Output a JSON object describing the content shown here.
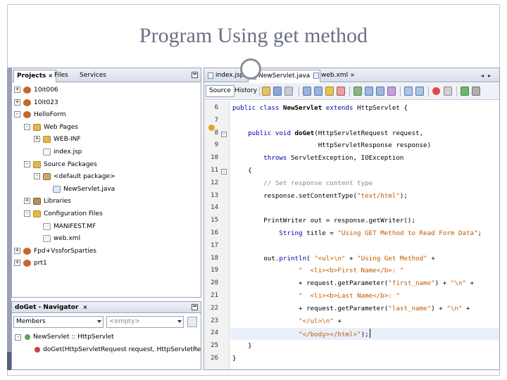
{
  "slide": {
    "title": "Program Using get method"
  },
  "projects_panel": {
    "tabs": [
      {
        "label": "Projects",
        "close": "×"
      },
      {
        "label": "Files"
      },
      {
        "label": "Services"
      }
    ],
    "tree": [
      {
        "label": "10it006",
        "icon": "project-icon",
        "expander": "+"
      },
      {
        "label": "10it023",
        "icon": "project-icon",
        "expander": "+"
      },
      {
        "label": "HelloForm",
        "icon": "project-icon",
        "expander": "-"
      },
      {
        "label": "Web Pages",
        "icon": "folder-icon",
        "expander": "-"
      },
      {
        "label": "WEB-INF",
        "icon": "folder-icon",
        "expander": "+"
      },
      {
        "label": "index.jsp",
        "icon": "file-icon"
      },
      {
        "label": "Source Packages",
        "icon": "folder-icon",
        "expander": "-"
      },
      {
        "label": "<default package>",
        "icon": "package-icon",
        "expander": "-"
      },
      {
        "label": "NewServlet.java",
        "icon": "java-file-icon"
      },
      {
        "label": "Libraries",
        "icon": "library-icon",
        "expander": "+"
      },
      {
        "label": "Configuration Files",
        "icon": "folder-icon",
        "expander": "-"
      },
      {
        "label": "MANIFEST.MF",
        "icon": "file-icon"
      },
      {
        "label": "web.xml",
        "icon": "file-icon"
      },
      {
        "label": "Fpd+VssforSparties",
        "icon": "project-icon",
        "expander": "+"
      },
      {
        "label": "prt1",
        "icon": "project-icon",
        "expander": "+"
      }
    ]
  },
  "navigator": {
    "title": "doGet - Navigator",
    "close": "×",
    "filter": "Members",
    "empty_label": "<empty>",
    "items": [
      {
        "label": "NewServlet :: HttpServlet",
        "icon": "class-icon"
      },
      {
        "label": "doGet(HttpServletRequest request, HttpServletResponse response",
        "icon": "method-icon"
      }
    ]
  },
  "editor": {
    "tabs": [
      {
        "label": "index.jsp",
        "close": "×"
      },
      {
        "label": "NewServlet.java",
        "close": "×"
      },
      {
        "label": "web.xml",
        "close": "×"
      }
    ],
    "toolbar": {
      "source_label": "Source",
      "history_label": "History"
    },
    "lines": [
      {
        "num": "6",
        "fold": "",
        "parts": [
          [
            "kw",
            "public class "
          ],
          [
            "cls",
            "NewServlet"
          ],
          [
            "kw",
            " extends "
          ],
          [
            "",
            "HttpServlet {"
          ]
        ]
      },
      {
        "num": "7",
        "fold": "",
        "parts": []
      },
      {
        "num": "8",
        "fold": "-",
        "parts": [
          [
            "kw",
            "    public void "
          ],
          [
            "cls",
            "doGet"
          ],
          [
            "",
            "(HttpServletRequest request,"
          ]
        ]
      },
      {
        "num": "9",
        "fold": "",
        "parts": [
          [
            "",
            "                      HttpServletResponse response)"
          ]
        ]
      },
      {
        "num": "10",
        "fold": "",
        "parts": [
          [
            "kw",
            "        throws "
          ],
          [
            "",
            "ServletException, IOException"
          ]
        ]
      },
      {
        "num": "11",
        "fold": "-",
        "parts": [
          [
            "",
            "    {"
          ]
        ]
      },
      {
        "num": "12",
        "fold": "",
        "parts": [
          [
            "cmt",
            "        // Set response content type"
          ]
        ]
      },
      {
        "num": "13",
        "fold": "",
        "parts": [
          [
            "",
            "        response.setContentType("
          ],
          [
            "str",
            "\"text/html\""
          ],
          [
            "",
            ");"
          ]
        ]
      },
      {
        "num": "14",
        "fold": "",
        "parts": []
      },
      {
        "num": "15",
        "fold": "",
        "parts": [
          [
            "",
            "        PrintWriter out = response.getWriter();"
          ]
        ]
      },
      {
        "num": "16",
        "fold": "",
        "parts": [
          [
            "kw",
            "            String "
          ],
          [
            "",
            "title = "
          ],
          [
            "str",
            "\"Using GET Method to Read Form Data\""
          ],
          [
            "",
            ";"
          ]
        ]
      },
      {
        "num": "17",
        "fold": "",
        "parts": []
      },
      {
        "num": "18",
        "fold": "",
        "parts": [
          [
            "",
            "        out."
          ],
          [
            "kw",
            "println"
          ],
          [
            "",
            "( "
          ],
          [
            "str",
            "\"<ul>\\n\""
          ],
          [
            "",
            " + "
          ],
          [
            "str",
            "\"Using Get Method\""
          ],
          [
            "",
            " +"
          ]
        ]
      },
      {
        "num": "19",
        "fold": "",
        "parts": [
          [
            "",
            "                 "
          ],
          [
            "str",
            "\"  <li><b>First Name</b>: \""
          ]
        ]
      },
      {
        "num": "20",
        "fold": "",
        "parts": [
          [
            "",
            "                 + request.getParameter("
          ],
          [
            "str",
            "\"first_name\""
          ],
          [
            "",
            ") + "
          ],
          [
            "str",
            "\"\\n\""
          ],
          [
            "",
            " +"
          ]
        ]
      },
      {
        "num": "21",
        "fold": "",
        "parts": [
          [
            "",
            "                 "
          ],
          [
            "str",
            "\"  <li><b>Last Name</b>: \""
          ]
        ]
      },
      {
        "num": "22",
        "fold": "",
        "parts": [
          [
            "",
            "                 + request.getParameter("
          ],
          [
            "str",
            "\"last_name\""
          ],
          [
            "",
            ") + "
          ],
          [
            "str",
            "\"\\n\""
          ],
          [
            "",
            " +"
          ]
        ]
      },
      {
        "num": "23",
        "fold": "",
        "parts": [
          [
            "",
            "                 "
          ],
          [
            "str",
            "\"</ul>\\n\""
          ],
          [
            "",
            " +"
          ]
        ]
      },
      {
        "num": "24",
        "fold": "",
        "parts": [
          [
            "",
            "                 "
          ],
          [
            "str",
            "\"</body></html>\""
          ],
          [
            "",
            ");"
          ]
        ]
      },
      {
        "num": "25",
        "fold": "",
        "parts": [
          [
            "",
            "    }"
          ]
        ]
      },
      {
        "num": "26",
        "fold": "",
        "parts": [
          [
            "",
            "}"
          ]
        ]
      }
    ],
    "highlighted_line": "24"
  },
  "colors": {
    "keyword": "#0000aa",
    "string": "#c05a00",
    "comment": "#8a8a8a",
    "title": "#6b6f84"
  }
}
